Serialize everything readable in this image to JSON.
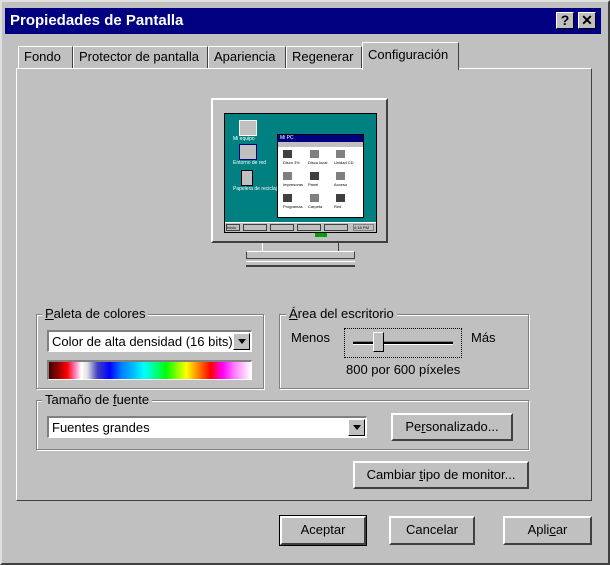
{
  "window": {
    "title": "Propiedades de Pantalla",
    "help_glyph": "?",
    "close_glyph": "✕"
  },
  "tabs": [
    {
      "label": "Fondo",
      "active": false
    },
    {
      "label": "Protector de pantalla",
      "active": false
    },
    {
      "label": "Apariencia",
      "active": false
    },
    {
      "label": "Regenerar",
      "active": false
    },
    {
      "label": "Configuración",
      "active": true
    }
  ],
  "preview": {
    "desktop_color": "#008080",
    "desktop_icons": [
      "Mi equipo",
      "Entorno de red",
      "Papelera de reciclaje"
    ],
    "window_title": "Mi PC",
    "window_icons": [
      "Disco 3½",
      "Disco local",
      "Unidad CD",
      "Impresoras",
      "Panel",
      "Acceso",
      "Programas",
      "Carpeta",
      "Red"
    ],
    "taskbar_start": "Inicio",
    "taskbar_clock": "4:18 PM"
  },
  "color_palette": {
    "label_prefix": "",
    "label_key": "P",
    "label_rest": "aleta de colores",
    "selected": "Color de alta densidad (16 bits)"
  },
  "desktop_area": {
    "label_key": "Á",
    "label_rest": "rea del escritorio",
    "less": "Menos",
    "more": "Más",
    "value_text": "800 por 600 píxeles",
    "slider_fraction": 0.25
  },
  "font_size": {
    "label_prefix": "Tamaño de ",
    "label_key": "f",
    "label_rest": "uente",
    "selected": "Fuentes grandes",
    "custom_prefix": "Pe",
    "custom_key": "r",
    "custom_rest": "sonalizado..."
  },
  "monitor_button": {
    "prefix": "Cambiar ",
    "key": "t",
    "rest": "ipo de monitor..."
  },
  "buttons": {
    "ok": "Aceptar",
    "cancel": "Cancelar",
    "apply_prefix": "Apli",
    "apply_key": "c",
    "apply_rest": "ar"
  },
  "colors": {
    "face": "#c0c0c0",
    "titlebar": "#000080",
    "desktop": "#008080"
  }
}
